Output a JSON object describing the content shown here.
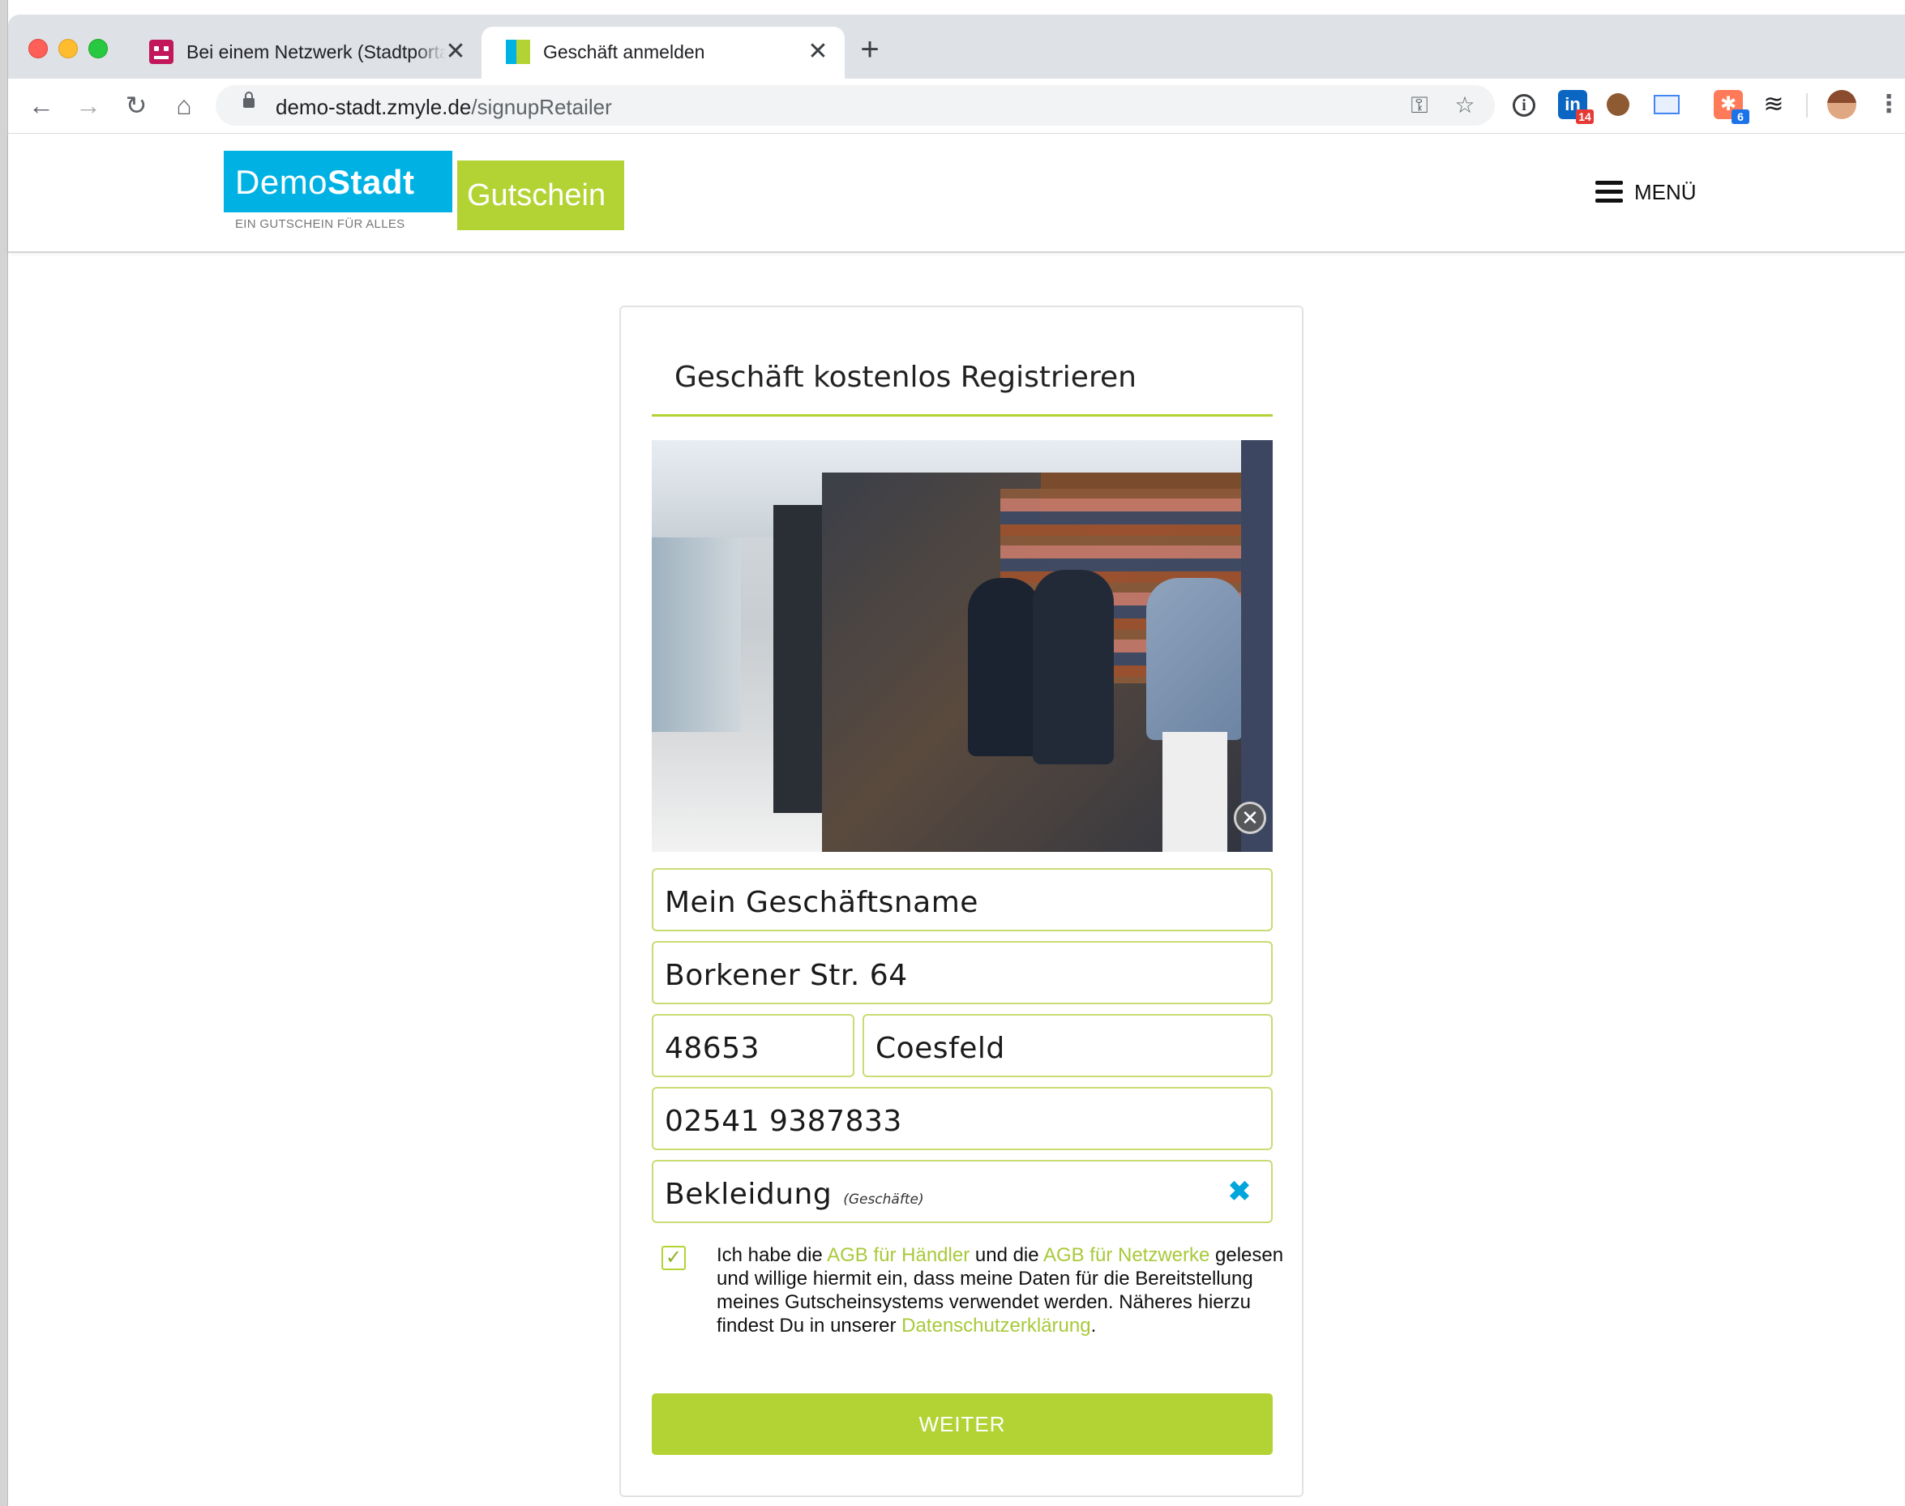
{
  "browser": {
    "tabs": [
      {
        "title": "Bei einem Netzwerk (Stadtportal",
        "close": "✕"
      },
      {
        "title": "Geschäft anmelden",
        "close": "✕"
      }
    ],
    "new_tab": "+",
    "url": {
      "host": "demo-stadt.zmyle.de",
      "path": "/signupRetailer"
    },
    "nav": {
      "back": "←",
      "forward": "→",
      "reload": "↻",
      "home": "⌂"
    },
    "omnibox_icons": {
      "key": "⚿",
      "star": "☆"
    },
    "extensions": {
      "info": "i",
      "linkedin": {
        "label": "in",
        "badge": "14"
      },
      "hubspot": {
        "label": "✱",
        "badge": "6"
      },
      "stack": "≋",
      "menu": "⋮"
    }
  },
  "header": {
    "logo": {
      "part1": "Demo",
      "part2": "Stadt",
      "badge": "Gutschein",
      "tagline": "EIN GUTSCHEIN FÜR ALLES"
    },
    "menu_label": "MENÜ"
  },
  "form": {
    "title": "Geschäft kostenlos Registrieren",
    "photo_remove": "✕",
    "fields": {
      "business_name": "Mein Geschäftsname",
      "street": "Borkener Str. 64",
      "zip": "48653",
      "city": "Coesfeld",
      "phone": "02541 9387833",
      "category": "Bekleidung",
      "category_hint": "(Geschäfte)",
      "category_clear": "✖"
    },
    "consent": {
      "checked": true,
      "checkmark": "✓",
      "text_1": "Ich habe die ",
      "link_1": "AGB für Händler",
      "text_2": " und die ",
      "link_2": "AGB für Netzwerke",
      "text_3": " gelesen und willige hiermit ein, dass meine Daten für die Bereitstellung meines Gutscheinsystems verwendet werden. Näheres hierzu findest Du in unserer ",
      "link_3": "Datenschutzerklärung",
      "text_4": "."
    },
    "submit_label": "WEITER"
  },
  "colors": {
    "brand_blue": "#00b2e3",
    "brand_green": "#b3d334",
    "link_green": "#a9c93a",
    "clear_icon_blue": "#00a5dc"
  }
}
